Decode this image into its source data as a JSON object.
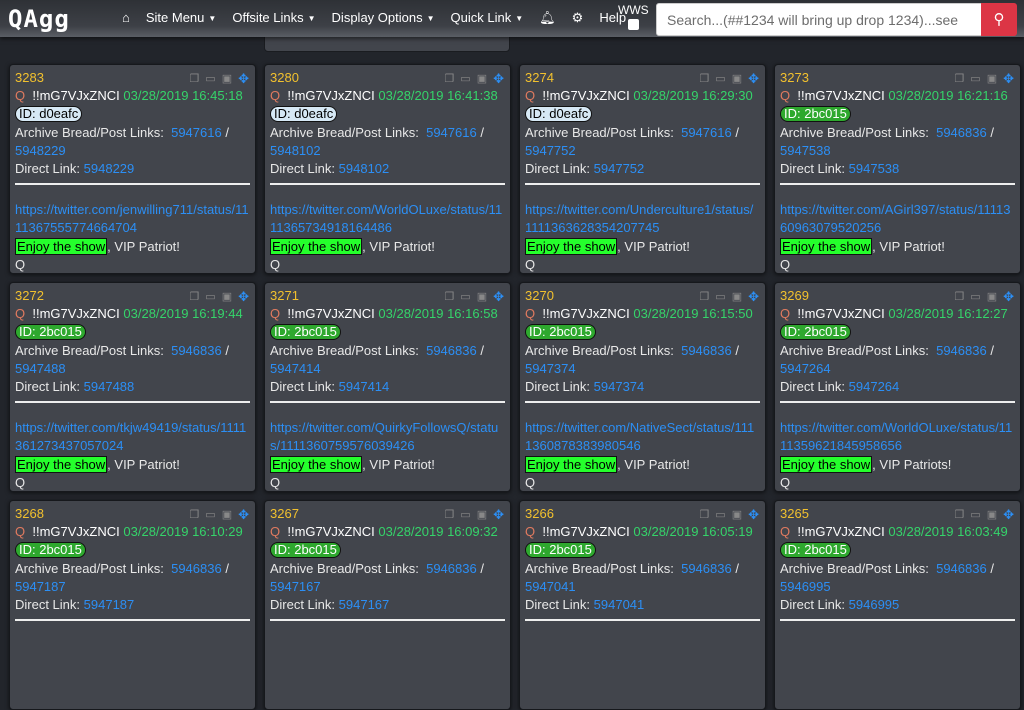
{
  "nav": {
    "logo": "QAgg",
    "items": [
      {
        "label": "Site Menu"
      },
      {
        "label": "Offsite Links"
      },
      {
        "label": "Display Options"
      },
      {
        "label": "Quick Link"
      }
    ],
    "help": "Help",
    "wws": "WWS",
    "search_placeholder": "Search...(##1234 will bring up drop 1234)...see"
  },
  "labels": {
    "archive": "Archive Bread/Post Links:",
    "direct": "Direct Link:",
    "enjoy": "Enjoy the show",
    "q": "Q",
    "sign": "Q"
  },
  "colors": {
    "accent": "#2c8ff5",
    "number": "#f2c12e",
    "date": "#35d46a",
    "search_button": "#dc3545",
    "highlight": "#25ff2c"
  },
  "cards": [
    {
      "num": "3283",
      "trip": "!!mG7VJxZNCI",
      "date": "03/28/2019 16:45:18",
      "id": "ID: d0eafc",
      "id_style": "blue",
      "bread": "5947616",
      "post": "5948229",
      "url": "https://twitter.com/jenwilling711/status/1111367555774664704",
      "tail": ", VIP Patriot!"
    },
    {
      "num": "3280",
      "trip": "!!mG7VJxZNCI",
      "date": "03/28/2019 16:41:38",
      "id": "ID: d0eafc",
      "id_style": "blue",
      "bread": "5947616",
      "post": "5948102",
      "url": "https://twitter.com/WorldOLuxe/status/1111365734918164486",
      "tail": ", VIP Patriot!"
    },
    {
      "num": "3274",
      "trip": "!!mG7VJxZNCI",
      "date": "03/28/2019 16:29:30",
      "id": "ID: d0eafc",
      "id_style": "blue",
      "bread": "5947616",
      "post": "5947752",
      "url": "https://twitter.com/Underculture1/status/1111363628354207745",
      "tail": ", VIP Patriot!"
    },
    {
      "num": "3273",
      "trip": "!!mG7VJxZNCI",
      "date": "03/28/2019 16:21:16",
      "id": "ID: 2bc015",
      "id_style": "green",
      "bread": "5946836",
      "post": "5947538",
      "url": "https://twitter.com/AGirl397/status/1111360963079520256",
      "tail": ", VIP Patriot!"
    },
    {
      "num": "3272",
      "trip": "!!mG7VJxZNCI",
      "date": "03/28/2019 16:19:44",
      "id": "ID: 2bc015",
      "id_style": "green",
      "bread": "5946836",
      "post": "5947488",
      "url": "https://twitter.com/tkjw49419/status/1111361273437057024",
      "tail": ", VIP Patriot!"
    },
    {
      "num": "3271",
      "trip": "!!mG7VJxZNCI",
      "date": "03/28/2019 16:16:58",
      "id": "ID: 2bc015",
      "id_style": "green",
      "bread": "5946836",
      "post": "5947414",
      "url": "https://twitter.com/QuirkyFollowsQ/status/1111360759576039426",
      "tail": ", VIP Patriot!"
    },
    {
      "num": "3270",
      "trip": "!!mG7VJxZNCI",
      "date": "03/28/2019 16:15:50",
      "id": "ID: 2bc015",
      "id_style": "green",
      "bread": "5946836",
      "post": "5947374",
      "url": "https://twitter.com/NativeSect/status/1111360878383980546",
      "tail": ", VIP Patriot!"
    },
    {
      "num": "3269",
      "trip": "!!mG7VJxZNCI",
      "date": "03/28/2019 16:12:27",
      "id": "ID: 2bc015",
      "id_style": "green",
      "bread": "5946836",
      "post": "5947264",
      "url": "https://twitter.com/WorldOLuxe/status/1111359621845958656",
      "tail": ", VIP Patriots!"
    },
    {
      "num": "3268",
      "trip": "!!mG7VJxZNCI",
      "date": "03/28/2019 16:10:29",
      "id": "ID: 2bc015",
      "id_style": "green",
      "bread": "5946836",
      "post": "5947187"
    },
    {
      "num": "3267",
      "trip": "!!mG7VJxZNCI",
      "date": "03/28/2019 16:09:32",
      "id": "ID: 2bc015",
      "id_style": "green",
      "bread": "5946836",
      "post": "5947167"
    },
    {
      "num": "3266",
      "trip": "!!mG7VJxZNCI",
      "date": "03/28/2019 16:05:19",
      "id": "ID: 2bc015",
      "id_style": "green",
      "bread": "5946836",
      "post": "5947041"
    },
    {
      "num": "3265",
      "trip": "!!mG7VJxZNCI",
      "date": "03/28/2019 16:03:49",
      "id": "ID: 2bc015",
      "id_style": "green",
      "bread": "5946836",
      "post": "5946995"
    }
  ]
}
